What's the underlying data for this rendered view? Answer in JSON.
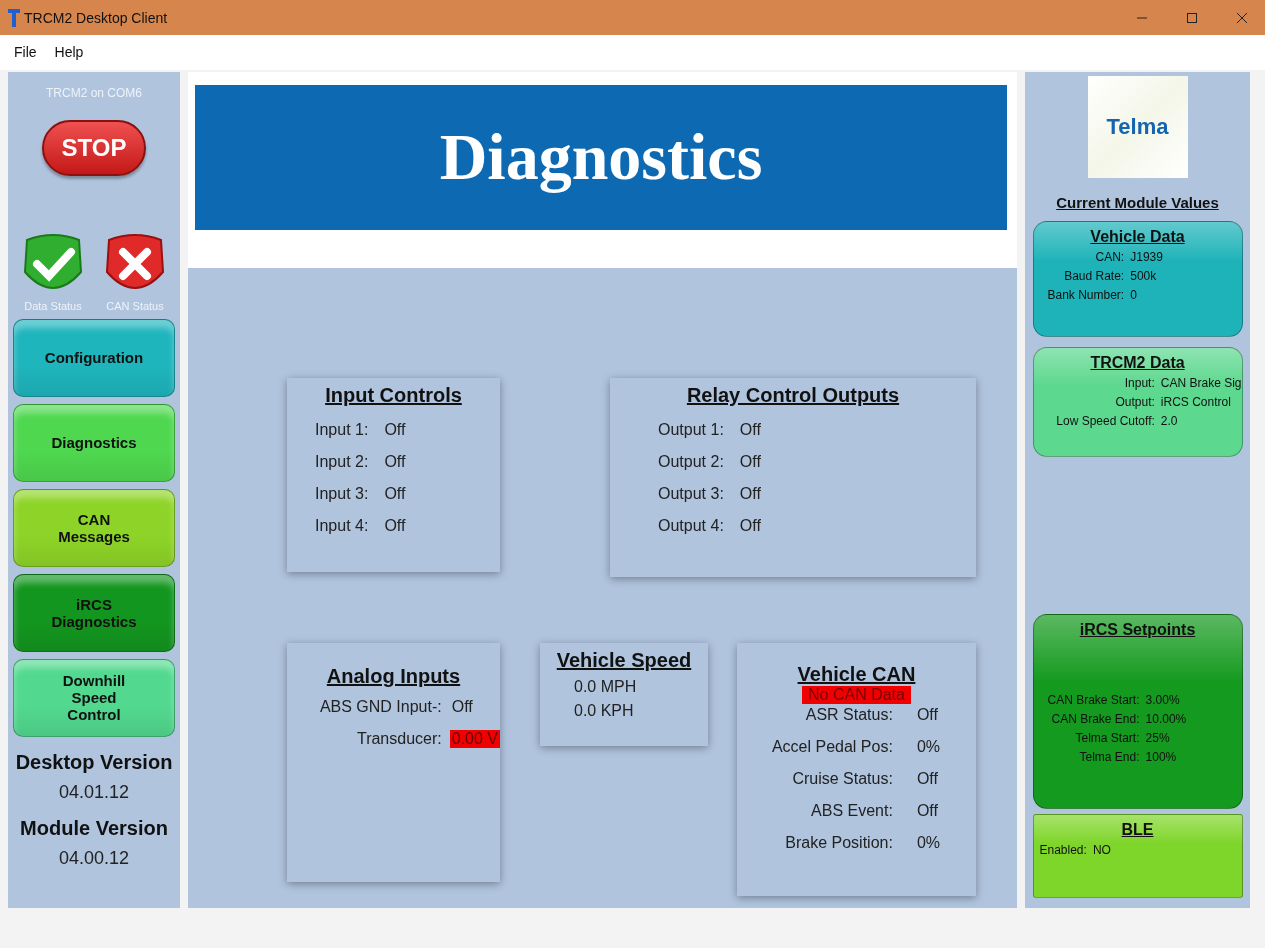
{
  "window": {
    "title": "TRCM2 Desktop Client"
  },
  "menu": [
    "File",
    "Help"
  ],
  "sidebar": {
    "connection": "TRCM2 on COM6",
    "stop_button": "STOP",
    "indicators": [
      {
        "label": "Data Status",
        "ok": true
      },
      {
        "label": "CAN Status",
        "ok": false
      }
    ],
    "nav": [
      {
        "label": "Configuration",
        "color": "#1fb5bd"
      },
      {
        "label": "Diagnostics",
        "color": "#4fd84f"
      },
      {
        "label": "CAN Messages",
        "color": "#8ed428"
      },
      {
        "label": "iRCS Diagnostics",
        "color": "#13961f"
      },
      {
        "label": "Downhill Speed Control",
        "color": "#52d98f"
      }
    ],
    "versions": [
      {
        "label": "Desktop Version",
        "value": "04.01.12"
      },
      {
        "label": "Module Version",
        "value": "04.00.12"
      }
    ]
  },
  "header": {
    "title": "Diagnostics"
  },
  "input_controls": {
    "title": "Input Controls",
    "rows": [
      {
        "label": "Input 1:",
        "value": "Off"
      },
      {
        "label": "Input 2:",
        "value": "Off"
      },
      {
        "label": "Input 3:",
        "value": "Off"
      },
      {
        "label": "Input 4:",
        "value": "Off"
      }
    ]
  },
  "relay_outputs": {
    "title": "Relay Control Outputs",
    "rows": [
      {
        "label": "Output 1:",
        "value": "Off"
      },
      {
        "label": "Output 2:",
        "value": "Off"
      },
      {
        "label": "Output 3:",
        "value": "Off"
      },
      {
        "label": "Output 4:",
        "value": "Off"
      }
    ]
  },
  "analog_inputs": {
    "title": "Analog Inputs",
    "rows": [
      {
        "label": "ABS GND Input-:",
        "value": "Off",
        "alert": false
      },
      {
        "label": "Transducer:",
        "value": "0.00 V",
        "alert": true
      }
    ]
  },
  "vehicle_speed": {
    "title": "Vehicle Speed",
    "lines": [
      "0.0 MPH",
      "0.0 KPH"
    ]
  },
  "vehicle_can": {
    "title": "Vehicle CAN",
    "status": "No CAN Data",
    "rows": [
      {
        "label": "ASR Status:",
        "value": "Off"
      },
      {
        "label": "Accel Pedal Pos:",
        "value": "0%"
      },
      {
        "label": "Cruise Status:",
        "value": "Off"
      },
      {
        "label": "ABS Event:",
        "value": "Off"
      },
      {
        "label": "Brake Position:",
        "value": "0%"
      }
    ]
  },
  "right_panel": {
    "logo": "Telma",
    "heading": "Current Module Values",
    "cards": [
      {
        "title": "Vehicle Data",
        "color": "#1db3b8",
        "rows": [
          {
            "label": "CAN:",
            "value": "J1939"
          },
          {
            "label": "Baud Rate:",
            "value": "500k"
          },
          {
            "label": "Bank Number:",
            "value": "0"
          }
        ]
      },
      {
        "title": "TRCM2 Data",
        "color": "#5dd88f",
        "rows": [
          {
            "label": "Input:",
            "value": "CAN Brake Sig"
          },
          {
            "label": "Output:",
            "value": "iRCS Control"
          },
          {
            "label": "Low Speed Cutoff:",
            "value": "2.0"
          }
        ]
      },
      {
        "title": "iRCS Setpoints",
        "color": "#149a1e",
        "rows": [
          {
            "label": "CAN Brake Start:",
            "value": "3.00%"
          },
          {
            "label": "CAN Brake End:",
            "value": "10.00%"
          },
          {
            "label": "Telma Start:",
            "value": "25%"
          },
          {
            "label": "Telma End:",
            "value": "100%"
          }
        ]
      },
      {
        "title": "BLE",
        "color": "#7fd62a",
        "rows": [
          {
            "label": "Enabled:",
            "value": "NO"
          }
        ]
      }
    ]
  }
}
